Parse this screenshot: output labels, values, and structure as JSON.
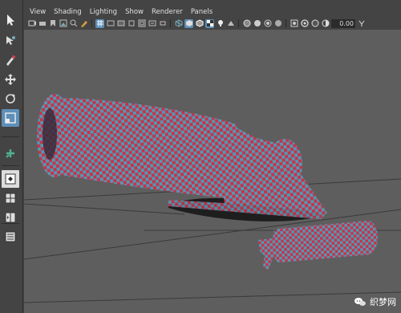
{
  "menu": {
    "items": [
      "View",
      "Shading",
      "Lighting",
      "Show",
      "Renderer",
      "Panels"
    ]
  },
  "toolbar": {
    "value": "0.00"
  },
  "left_toolbox": {
    "tools": [
      "select-tool",
      "lasso-tool",
      "paint-select-tool",
      "move-tool",
      "rotate-tool",
      "scale-tool",
      "last-tool",
      "layout-single",
      "layout-four",
      "layout-two",
      "outliner-layout"
    ]
  },
  "viewport": {
    "checker_colors": [
      "#c8334a",
      "#4f9ab5"
    ],
    "object_names": [
      "cannon-barrel",
      "cannon-cap",
      "cannon-base-wedge",
      "cannon-shadow",
      "small-cylinder"
    ]
  },
  "watermark": {
    "text": "织梦网"
  },
  "colors": {
    "ui_bg": "#444444",
    "viewport_bg": "#5e5e5e",
    "accent": "#5d8fb8"
  }
}
